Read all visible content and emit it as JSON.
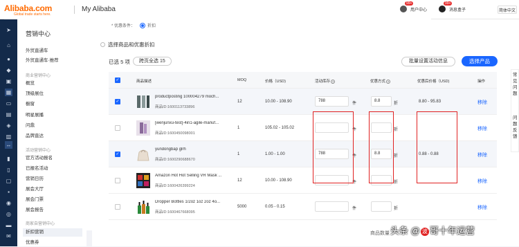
{
  "header": {
    "logo_main": "Alibaba.com",
    "logo_sub": "Global trade starts here.",
    "title": "My Alibaba",
    "user_center_label": "用户中心",
    "user_center_badge": "99+",
    "message_box_label": "消息盒子",
    "message_box_badge": "99+",
    "language": "简体中文"
  },
  "icon_bar": [
    "send-icon",
    "home-icon",
    "person-icon",
    "shield-icon",
    "tag-icon",
    "grid-icon",
    "monitor-icon",
    "cart-icon",
    "bag-icon",
    "chart-icon",
    "people-icon",
    "arrow-icon",
    "clipboard-icon",
    "document-icon",
    "box-icon",
    "thumbs-up-icon",
    "settings-icon",
    "folder-icon",
    "message-icon",
    "list-icon"
  ],
  "sidebar": {
    "head": "营销中心",
    "items": [
      {
        "label": "外贸直通车",
        "type": "item"
      },
      {
        "label": "外贸直通车·推荐",
        "type": "item"
      },
      {
        "label": "商业营销中心",
        "type": "group"
      },
      {
        "label": "概览",
        "type": "item"
      },
      {
        "label": "顶级展位",
        "type": "item"
      },
      {
        "label": "橱窗",
        "type": "item"
      },
      {
        "label": "明星展播",
        "type": "item"
      },
      {
        "label": "问鼎",
        "type": "item"
      },
      {
        "label": "品牌直达",
        "type": "item"
      },
      {
        "label": "活动营销中心",
        "type": "group"
      },
      {
        "label": "官方活动报名",
        "type": "item"
      },
      {
        "label": "已报名活动",
        "type": "item"
      },
      {
        "label": "营销日历",
        "type": "item"
      },
      {
        "label": "展会大厅",
        "type": "item"
      },
      {
        "label": "展会门票",
        "type": "item"
      },
      {
        "label": "展会报告",
        "type": "item"
      },
      {
        "label": "商家自营销中心",
        "type": "group"
      },
      {
        "label": "折扣营销",
        "type": "item",
        "active": true
      },
      {
        "label": "优惠券",
        "type": "item"
      }
    ]
  },
  "main": {
    "condition_label": "* 优惠条件：",
    "condition_value": "折扣",
    "section_title": "选择商品和优惠折扣",
    "selected_info": "已选 5 项",
    "select_all_pages": "跨页全选 15",
    "batch_button": "批量设置活动信息",
    "select_product_button": "选择产品",
    "columns": {
      "product": "商品描述",
      "moq": "MOQ",
      "price": "价格（USD)",
      "stock": "活动库存",
      "discount": "优惠方式",
      "discounted_price": "优惠后价格（USD)",
      "action": "操作"
    },
    "stock_unit": "件",
    "discount_unit": "折",
    "remove_label": "移除",
    "rows": [
      {
        "name": "productposting 100004279 moch...",
        "id": "商品ID:1600113733896",
        "moq": "12",
        "price": "10.00 - 108.90",
        "stock": "788",
        "discount": "8.8",
        "discounted": "8.80 - 95.83",
        "checked": true
      },
      {
        "name": "[wenjunxu-test]-4in1-agile-manuf...",
        "id": "商品ID:1600450098001",
        "moq": "1",
        "price": "105.02 - 105.02",
        "stock": "",
        "discount": "",
        "discounted": "",
        "checked": false
      },
      {
        "name": "yundongbap glrh",
        "id": "商品ID:1600290688670",
        "moq": "1",
        "price": "1.00 - 1.00",
        "stock": "788",
        "discount": "8.8",
        "discounted": "0.88 - 0.88",
        "checked": true
      },
      {
        "name": "Amazon Hot Hot Selling VR Mask ...",
        "id": "商品ID:1600426399224",
        "moq": "12",
        "price": "10.00 - 108.90",
        "stock": "",
        "discount": "",
        "discounted": "",
        "checked": false
      },
      {
        "name": "Dropper Bottles 1/2oz 1oz 2oz 4o...",
        "id": "商品ID:1600467668095",
        "moq": "5000",
        "price": "0.05 - 0.15",
        "stock": "",
        "discount": "",
        "discounted": "",
        "checked": false
      }
    ],
    "footer_text": "商品数量"
  },
  "float_panel": [
    "常",
    "见",
    "问",
    "题",
    "问",
    "题",
    "反",
    "馈"
  ],
  "watermark": {
    "prefix": "头条 @",
    "bubble": "波",
    "suffix": "哥十年运营"
  }
}
